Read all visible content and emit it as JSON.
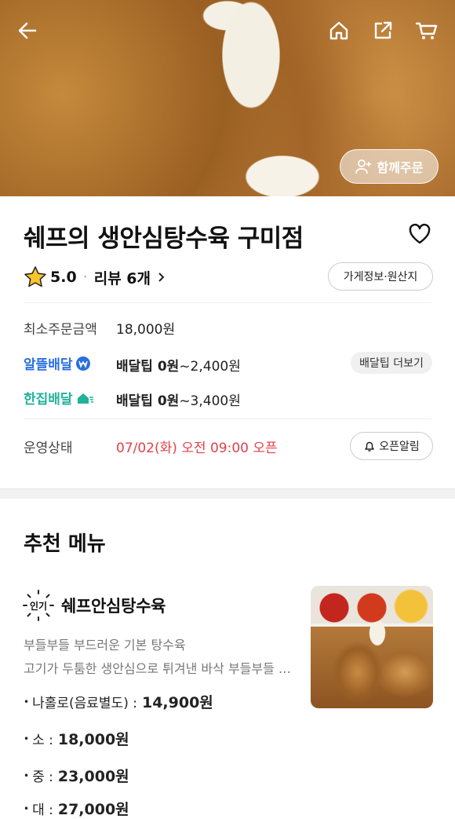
{
  "header": {
    "back_icon": "back-arrow-icon",
    "home_icon": "home-icon",
    "share_icon": "share-icon",
    "cart_icon": "cart-icon",
    "together_order_label": "함께주문"
  },
  "store": {
    "name": "쉐프의 생안심탕수육 구미점",
    "rating": "5.0",
    "review_label": "리뷰 6개",
    "info_button": "가게정보·원산지",
    "min_order_label": "최소주문금액",
    "min_order_value": "18,000원",
    "delivery_options": [
      {
        "brand": "알뜰배달",
        "tip_label": "배달팁 0원",
        "tip_range": "~2,400원"
      },
      {
        "brand": "한집배달",
        "tip_label": "배달팁 0원",
        "tip_range": "~3,400원"
      }
    ],
    "delivery_more_button": "배달팁 더보기",
    "status_label": "운영상태",
    "status_value": "07/02(화) 오전 09:00 오픈",
    "open_alarm_button": "오픈알림"
  },
  "recommended": {
    "title": "추천 메뉴",
    "items": [
      {
        "badge": "인기",
        "name": "쉐프안심탕수육",
        "desc1": "부들부들 부드러운 기본 탕수육",
        "desc2": "고기가 두툼한  생안심으로 튀겨낸 바삭 부들부들 탕수육",
        "prices": [
          {
            "label": "나홀로(음료별도) :",
            "price": "14,900원"
          },
          {
            "label": "소 :",
            "price": "18,000원"
          },
          {
            "label": "중 :",
            "price": "23,000원"
          },
          {
            "label": "대 :",
            "price": "27,000원"
          }
        ]
      }
    ]
  },
  "colors": {
    "accent_blue": "#2a6fe0",
    "accent_teal": "#20b39a",
    "status_red": "#e0414a"
  }
}
